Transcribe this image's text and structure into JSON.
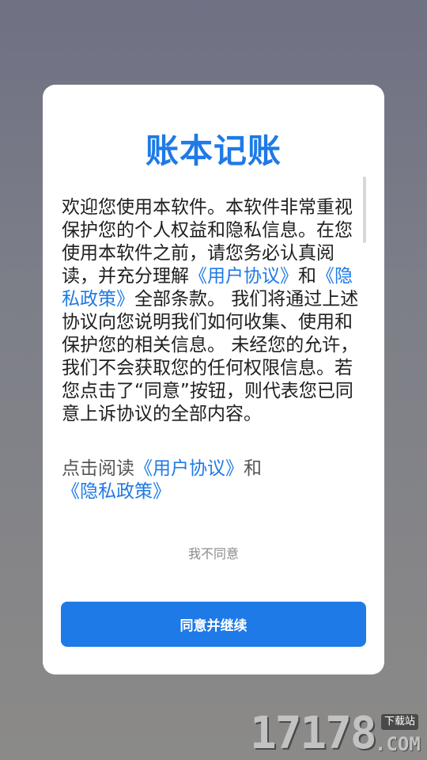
{
  "dialog": {
    "title": "账本记账",
    "body": {
      "intro": "欢迎您使用本软件。本软件非常重视保护您的个人权益和隐私信息。在您使用本软件之前，请您务必认真阅读，并充分理解",
      "link_user_agreement": "《用户协议》",
      "and": "和",
      "link_privacy_policy": "《隐私政策》",
      "rest": "全部条款。 我们将通过上述协议向您说明我们如何收集、使用和保护您的相关信息。 未经您的允许，我们不会获取您的任何权限信息。若您点击了“同意”按钮，则代表您已同意上诉协议的全部内容。"
    },
    "read_prompt": {
      "prefix": "点击阅读",
      "link_user_agreement": "《用户协议》",
      "and": "和",
      "link_privacy_policy": "《隐私政策》"
    },
    "disagree_label": "我不同意",
    "agree_label": "同意并继续"
  },
  "watermark": {
    "number": "17178",
    "domain": ".COM",
    "badge": "下载站"
  },
  "colors": {
    "accent": "#1e7ae6",
    "overlay": "#72737f"
  }
}
